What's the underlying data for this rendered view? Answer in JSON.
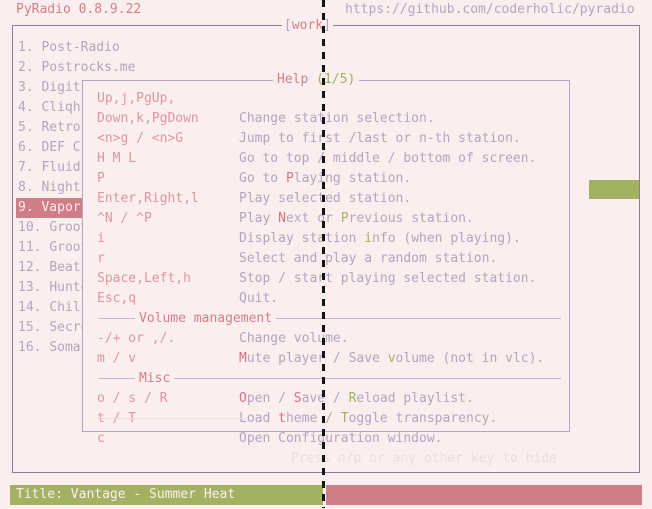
{
  "header": {
    "app_title": "PyRadio 0.8.9.22",
    "url": "https://github.com/coderholic/pyradio"
  },
  "main_frame": {
    "title_open_bracket": "[",
    "title_text": "work",
    "title_close_bracket": "]"
  },
  "stations": [
    {
      "index": "1.",
      "name": "Post-Radio",
      "selected": false
    },
    {
      "index": "2.",
      "name": "Postrocks.me",
      "selected": false
    },
    {
      "index": "3.",
      "name": "Digit",
      "selected": false
    },
    {
      "index": "4.",
      "name": "Cliqh",
      "selected": false
    },
    {
      "index": "5.",
      "name": "Retro",
      "selected": false
    },
    {
      "index": "6.",
      "name": "DEF C",
      "selected": false
    },
    {
      "index": "7.",
      "name": "Fluid",
      "selected": false
    },
    {
      "index": "8.",
      "name": "Night",
      "selected": false
    },
    {
      "index": "9.",
      "name": "Vapor",
      "selected": true
    },
    {
      "index": "10.",
      "name": "Groov",
      "selected": false
    },
    {
      "index": "11.",
      "name": "Groov",
      "selected": false
    },
    {
      "index": "12.",
      "name": "Beat",
      "selected": false
    },
    {
      "index": "13.",
      "name": "Hunte",
      "selected": false
    },
    {
      "index": "14.",
      "name": "Chill",
      "selected": false
    },
    {
      "index": "15.",
      "name": "Secre",
      "selected": false
    },
    {
      "index": "16.",
      "name": "SomaF",
      "selected": false
    }
  ],
  "help": {
    "title_label": "Help",
    "title_page": "(1/5)",
    "rows": [
      {
        "key": "Up,j,PgUp,",
        "desc_pre": "",
        "desc_hl": "",
        "desc_hl_color": "",
        "desc_post": ""
      },
      {
        "key": "Down,k,PgDown",
        "desc_pre": "Change station selection.",
        "desc_hl": "",
        "desc_hl_color": "",
        "desc_post": ""
      },
      {
        "key": "<n>g / <n>G",
        "desc_pre": "Jump to first /last or n-th station.",
        "desc_hl": "",
        "desc_hl_color": "",
        "desc_post": ""
      },
      {
        "key": "H M L",
        "desc_pre": "Go to top / middle / bottom of screen.",
        "desc_hl": "",
        "desc_hl_color": "",
        "desc_post": ""
      },
      {
        "key": "P",
        "desc_pre": "Go to ",
        "desc_hl": "P",
        "desc_hl_color": "red",
        "desc_post": "laying station."
      },
      {
        "key": "Enter,Right,l",
        "desc_pre": "Play selected station.",
        "desc_hl": "",
        "desc_hl_color": "",
        "desc_post": ""
      },
      {
        "key": "^N / ^P",
        "desc_pre": "Play ",
        "desc_hl": "N",
        "desc_hl_color": "red",
        "desc_post": "ext or "
      },
      {
        "key": "i",
        "desc_pre": "Display station ",
        "desc_hl": "i",
        "desc_hl_color": "green",
        "desc_post": "nfo (when playing)."
      },
      {
        "key": "r",
        "desc_pre": "Select and play a random station.",
        "desc_hl": "",
        "desc_hl_color": "",
        "desc_post": ""
      },
      {
        "key": "Space,Left,h",
        "desc_pre": "Stop / start playing selected station.",
        "desc_hl": "",
        "desc_hl_color": "",
        "desc_post": ""
      },
      {
        "key": "Esc,q",
        "desc_pre": "Quit.",
        "desc_hl": "",
        "desc_hl_color": "",
        "desc_post": ""
      }
    ],
    "row_extra_next": {
      "hl": "P",
      "hl_color": "green",
      "post": "revious station."
    },
    "section_volume_label": "Volume management",
    "volume_rows": [
      {
        "key": "-/+ or ,/.",
        "desc_pre": "Change volume.",
        "desc_hl": "",
        "desc_hl_color": "",
        "desc_post": ""
      },
      {
        "key": "m / v",
        "desc_pre": "",
        "desc_hl": "M",
        "desc_hl_color": "red",
        "desc_post": "ute player / Save "
      }
    ],
    "volume_row2_extra": {
      "hl": "v",
      "hl_color": "green",
      "post": "olume (not in vlc)."
    },
    "section_misc_label": "Misc",
    "misc_rows": [
      {
        "key": "o / s / R",
        "desc_pre": "",
        "desc_hl": "O",
        "desc_hl_color": "red",
        "desc_post": "pen / "
      },
      {
        "key": "t / T",
        "desc_pre": "Load ",
        "desc_hl": "t",
        "desc_hl_color": "red",
        "desc_post": "heme / "
      },
      {
        "key": "c",
        "desc_pre": "Open Configuration window.",
        "desc_hl": "",
        "desc_hl_color": "",
        "desc_post": ""
      }
    ],
    "misc_row1_extra": {
      "hl1": "S",
      "hl1_color": "red",
      "mid": "ave / ",
      "hl2": "R",
      "hl2_color": "green",
      "post": "eload playlist."
    },
    "misc_row2_extra": {
      "hl": "T",
      "hl_color": "green",
      "post": "oggle transparency."
    },
    "footer": "Press n/p or any other key to hide"
  },
  "status": {
    "title_text": "Title: Vantage - Summer Heat"
  },
  "colors": {
    "background": "#faeeee",
    "accent_pink": "#cf7d87",
    "accent_green": "#a3b163",
    "text_muted": "#b6a4bd",
    "border": "#8e7b96"
  }
}
